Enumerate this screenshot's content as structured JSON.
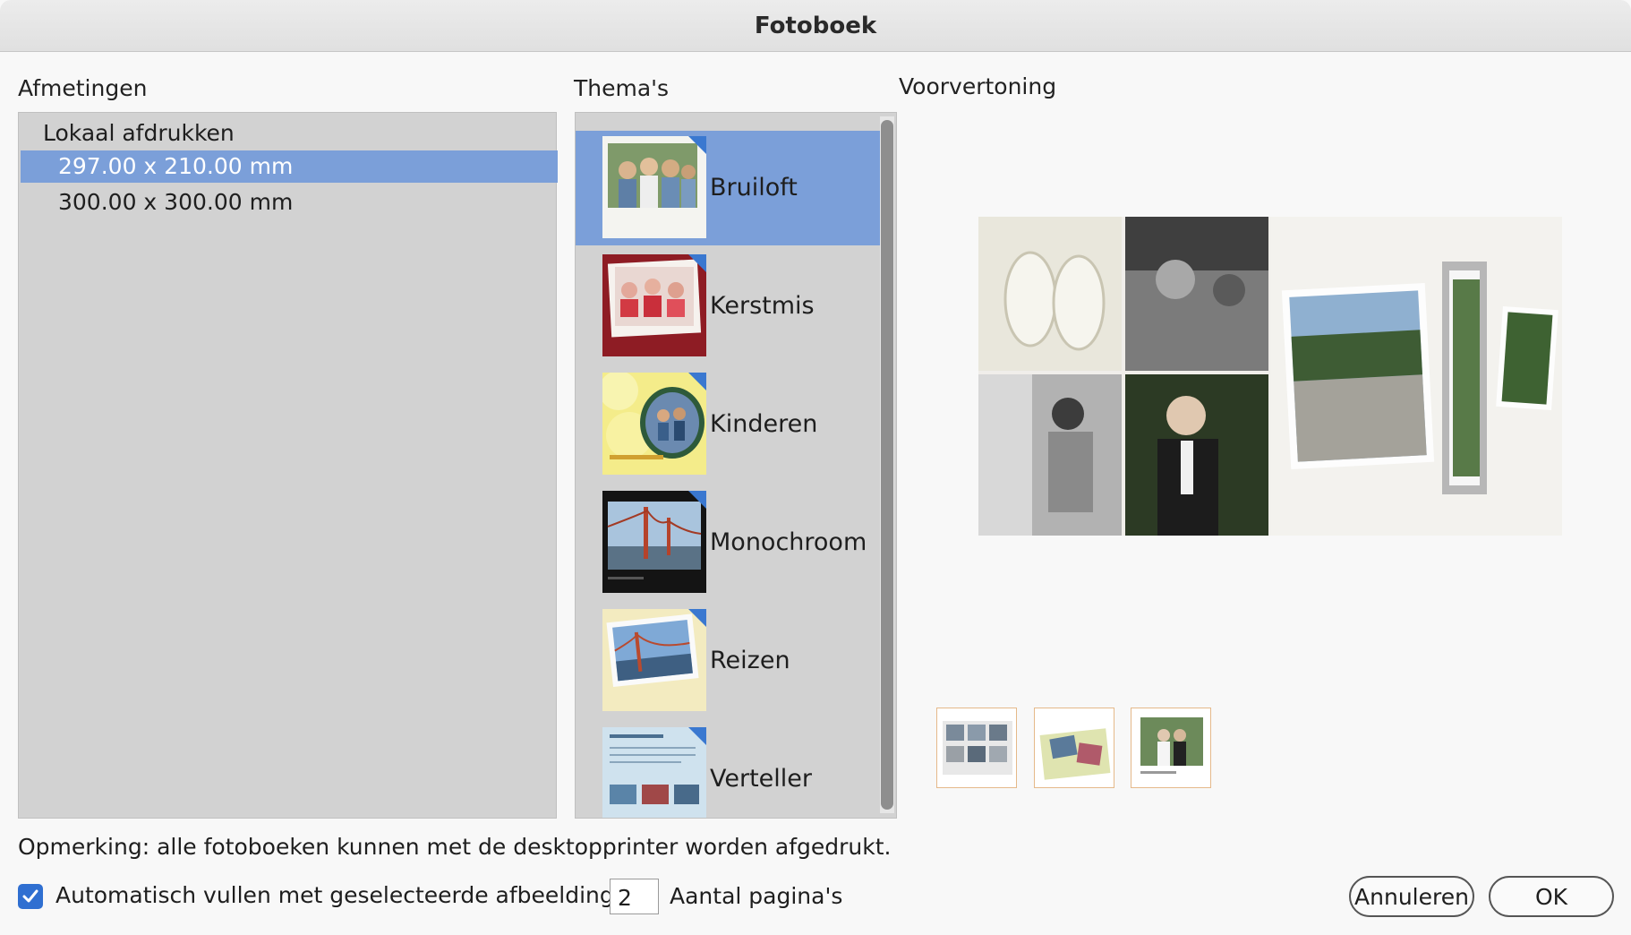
{
  "dialog": {
    "title": "Fotoboek"
  },
  "sections": {
    "sizes_label": "Afmetingen",
    "themes_label": "Thema's",
    "preview_label": "Voorvertoning"
  },
  "sizes": {
    "group": "Lokaal afdrukken",
    "items": [
      {
        "label": "297.00 x 210.00 mm",
        "selected": true
      },
      {
        "label": "300.00 x 300.00 mm",
        "selected": false
      }
    ]
  },
  "themes": [
    {
      "label": "Bruiloft",
      "icon": "wedding-thumbnail",
      "selected": true
    },
    {
      "label": "Kerstmis",
      "icon": "christmas-thumbnail",
      "selected": false
    },
    {
      "label": "Kinderen",
      "icon": "children-thumbnail",
      "selected": false
    },
    {
      "label": "Monochroom",
      "icon": "monochrome-thumbnail",
      "selected": false
    },
    {
      "label": "Reizen",
      "icon": "travel-thumbnail",
      "selected": false
    },
    {
      "label": "Verteller",
      "icon": "storyteller-thumbnail",
      "selected": false
    }
  ],
  "footer": {
    "note": "Opmerking: alle fotoboeken kunnen met de desktopprinter worden afgedrukt.",
    "autofill_label": "Automatisch vullen met geselecteerde afbeeldingen",
    "autofill_checked": true,
    "pages_value": "2",
    "pages_label": "Aantal pagina's",
    "cancel_label": "Annuleren",
    "ok_label": "OK"
  },
  "colors": {
    "selection": "#7b9fd9",
    "checkbox": "#2f6fd1",
    "thumb_border": "#e5b98a"
  }
}
